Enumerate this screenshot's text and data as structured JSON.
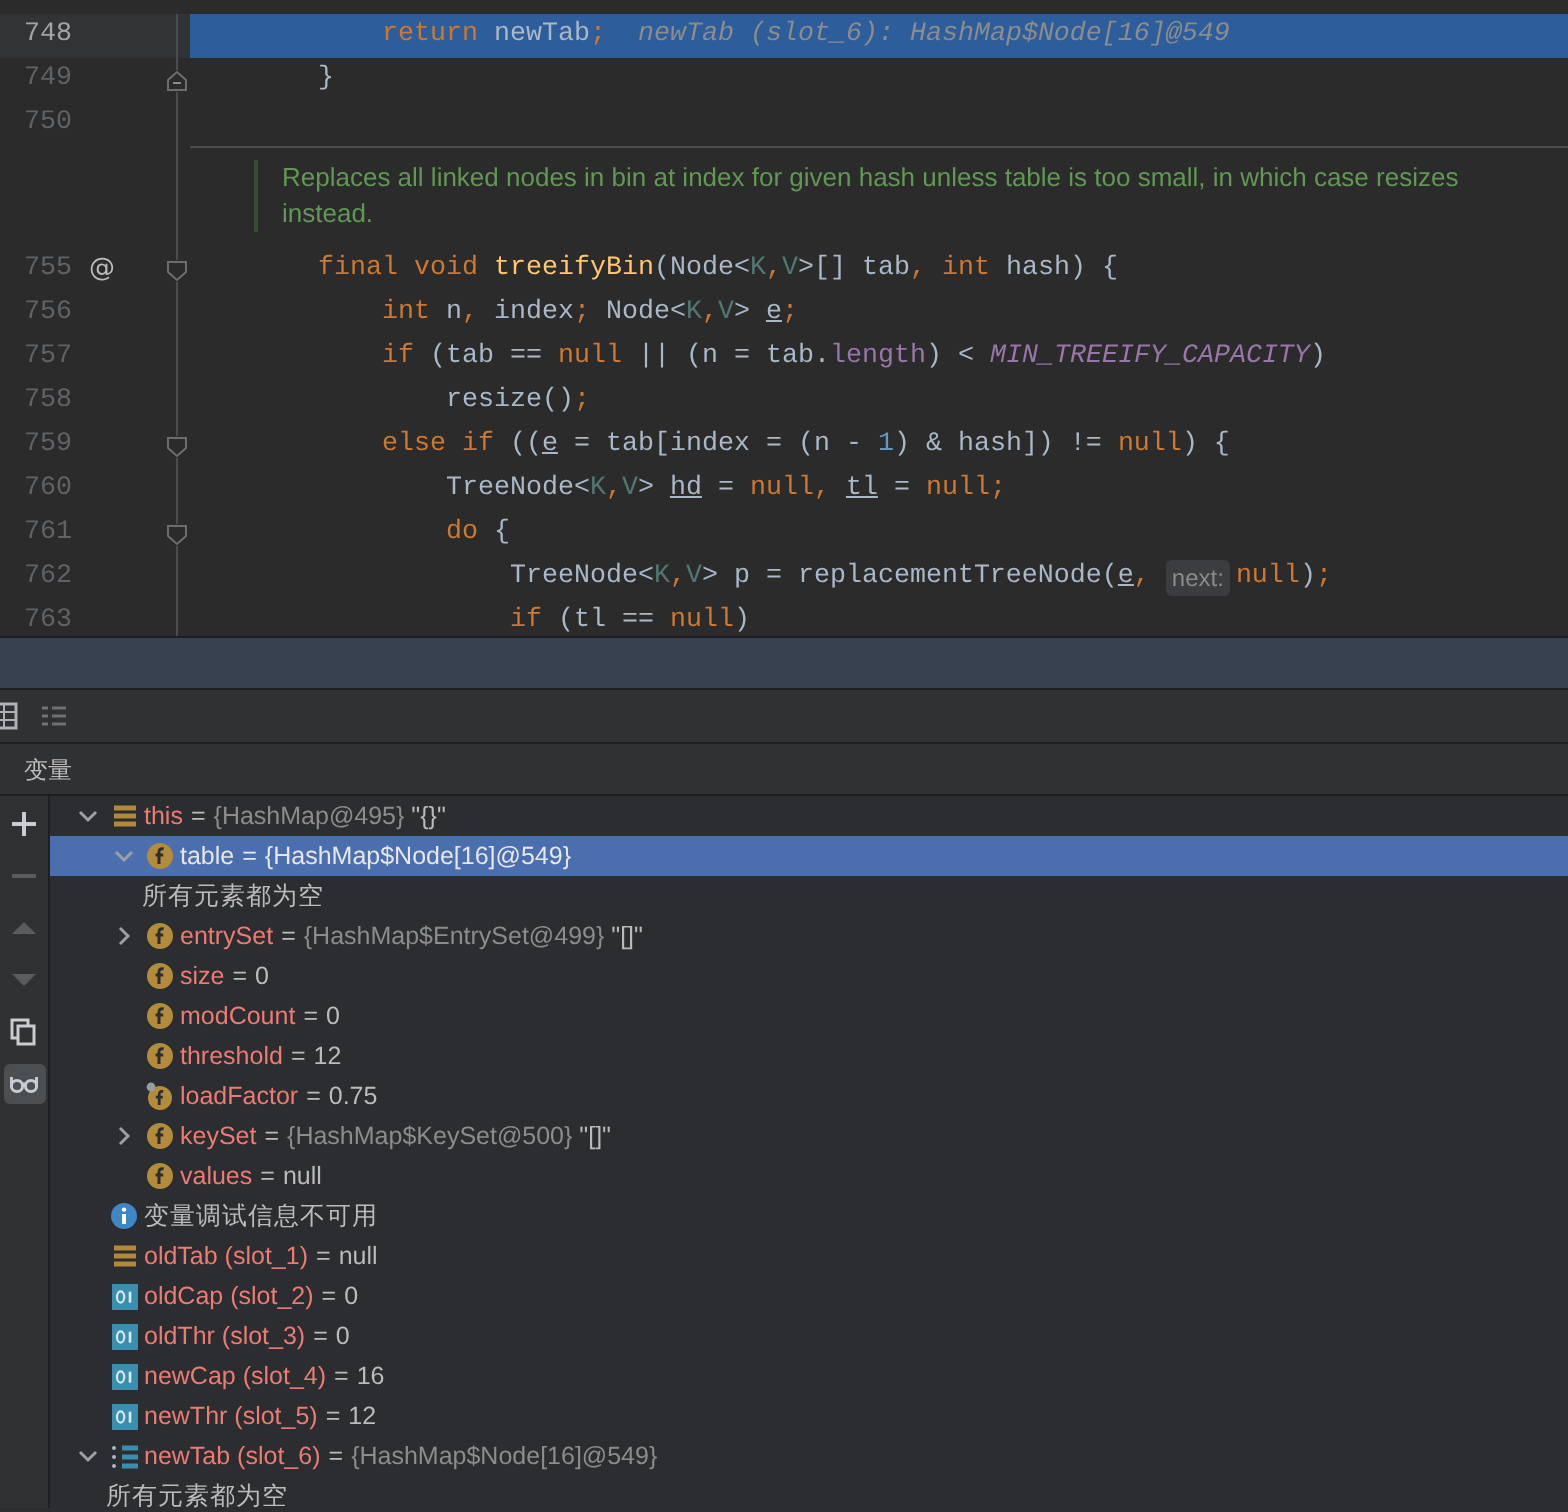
{
  "editor": {
    "lines": [
      {
        "kind": "line",
        "number": "748",
        "selected": true,
        "tokens": [
          {
            "kind": "kw",
            "text": "        return"
          },
          {
            "kind": "plain",
            "text": " newTab"
          },
          {
            "kind": "kw",
            "text": ";"
          },
          {
            "kind": "hint",
            "text": "newTab (slot_6): HashMap$Node[16]@549"
          }
        ]
      },
      {
        "kind": "fold_end",
        "number": "749",
        "selected": false,
        "tokens": [
          {
            "kind": "plain",
            "text": "    }"
          }
        ]
      },
      {
        "kind": "line",
        "number": "750",
        "selected": false
      },
      {
        "kind": "doc",
        "text": "Replaces all linked nodes in bin at index for given hash unless table is too small, in which case resizes instead."
      },
      {
        "kind": "fold_start",
        "number": "755",
        "selected": false,
        "gutter_mark": "@",
        "tokens": [
          {
            "kind": "kw",
            "text": "    final void "
          },
          {
            "kind": "fn",
            "text": "treeifyBin"
          },
          {
            "kind": "plain",
            "text": "(Node<"
          },
          {
            "kind": "tparam",
            "text": "K"
          },
          {
            "kind": "kw",
            "text": ","
          },
          {
            "kind": "tparam",
            "text": "V"
          },
          {
            "kind": "plain",
            "text": ">[] tab"
          },
          {
            "kind": "kw",
            "text": ", int "
          },
          {
            "kind": "plain",
            "text": "hash) {"
          }
        ]
      },
      {
        "kind": "line",
        "number": "756",
        "selected": false,
        "tokens": [
          {
            "kind": "kw",
            "text": "        int "
          },
          {
            "kind": "plain",
            "text": "n"
          },
          {
            "kind": "kw",
            "text": ", "
          },
          {
            "kind": "plain",
            "text": "index"
          },
          {
            "kind": "kw",
            "text": "; "
          },
          {
            "kind": "plain",
            "text": "Node<"
          },
          {
            "kind": "tparam",
            "text": "K"
          },
          {
            "kind": "kw",
            "text": ","
          },
          {
            "kind": "tparam",
            "text": "V"
          },
          {
            "kind": "plain",
            "text": "> "
          },
          {
            "kind": "var_u",
            "text": "e"
          },
          {
            "kind": "kw",
            "text": ";"
          }
        ]
      },
      {
        "kind": "line",
        "number": "757",
        "selected": false,
        "tokens": [
          {
            "kind": "kw",
            "text": "        if "
          },
          {
            "kind": "plain",
            "text": "(tab == "
          },
          {
            "kind": "kw",
            "text": "null "
          },
          {
            "kind": "plain",
            "text": "|| (n = tab."
          },
          {
            "kind": "field",
            "text": "length"
          },
          {
            "kind": "plain",
            "text": ") < "
          },
          {
            "kind": "const",
            "text": "MIN_TREEIFY_CAPACITY"
          },
          {
            "kind": "plain",
            "text": ")"
          }
        ]
      },
      {
        "kind": "line",
        "number": "758",
        "selected": false,
        "tokens": [
          {
            "kind": "plain",
            "text": "            resize()"
          },
          {
            "kind": "kw",
            "text": ";"
          }
        ]
      },
      {
        "kind": "fold_start",
        "number": "759",
        "selected": false,
        "tokens": [
          {
            "kind": "kw",
            "text": "        else if "
          },
          {
            "kind": "plain",
            "text": "(("
          },
          {
            "kind": "var_u",
            "text": "e"
          },
          {
            "kind": "plain",
            "text": " = tab[index = (n - "
          },
          {
            "kind": "num",
            "text": "1"
          },
          {
            "kind": "plain",
            "text": ") & hash]) != "
          },
          {
            "kind": "kw",
            "text": "null"
          },
          {
            "kind": "plain",
            "text": ") {"
          }
        ]
      },
      {
        "kind": "line",
        "number": "760",
        "selected": false,
        "tokens": [
          {
            "kind": "plain",
            "text": "            TreeNode<"
          },
          {
            "kind": "tparam",
            "text": "K"
          },
          {
            "kind": "kw",
            "text": ","
          },
          {
            "kind": "tparam",
            "text": "V"
          },
          {
            "kind": "plain",
            "text": "> "
          },
          {
            "kind": "var_u",
            "text": "hd"
          },
          {
            "kind": "plain",
            "text": " = "
          },
          {
            "kind": "kw",
            "text": "null, "
          },
          {
            "kind": "var_u",
            "text": "tl"
          },
          {
            "kind": "plain",
            "text": " = "
          },
          {
            "kind": "kw",
            "text": "null;"
          }
        ]
      },
      {
        "kind": "fold_start",
        "number": "761",
        "selected": false,
        "tokens": [
          {
            "kind": "kw",
            "text": "            do "
          },
          {
            "kind": "plain",
            "text": "{"
          }
        ]
      },
      {
        "kind": "line",
        "number": "762",
        "selected": false,
        "tokens": [
          {
            "kind": "plain",
            "text": "                TreeNode<"
          },
          {
            "kind": "tparam",
            "text": "K"
          },
          {
            "kind": "kw",
            "text": ","
          },
          {
            "kind": "tparam",
            "text": "V"
          },
          {
            "kind": "plain",
            "text": "> p = replacementTreeNode("
          },
          {
            "kind": "var_u",
            "text": "e"
          },
          {
            "kind": "kw",
            "text": ", "
          },
          {
            "kind": "inlay",
            "text": "next:"
          },
          {
            "kind": "kw",
            "text": "null"
          },
          {
            "kind": "plain",
            "text": ")"
          },
          {
            "kind": "kw",
            "text": ";"
          }
        ]
      },
      {
        "kind": "line",
        "number": "763",
        "selected": false,
        "tokens": [
          {
            "kind": "kw",
            "text": "                if "
          },
          {
            "kind": "plain",
            "text": "(tl == "
          },
          {
            "kind": "kw",
            "text": "null"
          },
          {
            "kind": "plain",
            "text": ")"
          }
        ]
      }
    ]
  },
  "debugger": {
    "toolbar": [
      {
        "kind": "table"
      },
      {
        "kind": "list"
      }
    ],
    "header": "变量",
    "side_tools": [
      {
        "kind": "add",
        "disabled": false,
        "selected": false
      },
      {
        "kind": "remove",
        "disabled": true,
        "selected": false
      },
      {
        "kind": "up",
        "disabled": true,
        "selected": false
      },
      {
        "kind": "down",
        "disabled": true,
        "selected": false
      },
      {
        "kind": "copy",
        "disabled": false,
        "selected": false
      },
      {
        "kind": "glasses",
        "disabled": false,
        "selected": true
      }
    ],
    "variables": [
      {
        "kind": "object",
        "name": "this",
        "separator": "=",
        "value": "{HashMap@495}",
        "summary": "\"{}\"",
        "expanded": true,
        "selected": false,
        "children": [
          {
            "kind": "field",
            "name": "table",
            "separator": "=",
            "value": "{HashMap$Node[16]@549}",
            "expanded": true,
            "selected": true,
            "children": [
              {
                "kind": "message",
                "text": "所有元素都为空"
              }
            ]
          },
          {
            "kind": "field",
            "name": "entrySet",
            "separator": "=",
            "value": "{HashMap$EntrySet@499}",
            "summary": "\"[]\"",
            "expanded": false,
            "selected": false
          },
          {
            "kind": "field",
            "name": "size",
            "separator": "=",
            "plain_value": "0",
            "selected": false
          },
          {
            "kind": "field",
            "name": "modCount",
            "separator": "=",
            "plain_value": "0",
            "selected": false
          },
          {
            "kind": "field",
            "name": "threshold",
            "separator": "=",
            "plain_value": "12",
            "selected": false
          },
          {
            "kind": "field_marked",
            "name": "loadFactor",
            "separator": "=",
            "plain_value": "0.75",
            "selected": false
          },
          {
            "kind": "field",
            "name": "keySet",
            "separator": "=",
            "value": "{HashMap$KeySet@500}",
            "summary": "\"[]\"",
            "expanded": false,
            "selected": false
          },
          {
            "kind": "field",
            "name": "values",
            "separator": "=",
            "plain_value": "null",
            "selected": false
          }
        ]
      },
      {
        "kind": "info",
        "text": "变量调试信息不可用"
      },
      {
        "kind": "object",
        "name": "oldTab (slot_1)",
        "separator": "=",
        "plain_value": "null",
        "selected": false
      },
      {
        "kind": "number",
        "name": "oldCap (slot_2)",
        "separator": "=",
        "plain_value": "0",
        "selected": false
      },
      {
        "kind": "number",
        "name": "oldThr (slot_3)",
        "separator": "=",
        "plain_value": "0",
        "selected": false
      },
      {
        "kind": "number",
        "name": "newCap (slot_4)",
        "separator": "=",
        "plain_value": "16",
        "selected": false
      },
      {
        "kind": "number",
        "name": "newThr (slot_5)",
        "separator": "=",
        "plain_value": "12",
        "selected": false
      },
      {
        "kind": "array",
        "name": "newTab (slot_6)",
        "separator": "=",
        "value": "{HashMap$Node[16]@549}",
        "expanded": true,
        "selected": false,
        "children": [
          {
            "kind": "message",
            "text": "所有元素都为空"
          }
        ]
      }
    ]
  }
}
